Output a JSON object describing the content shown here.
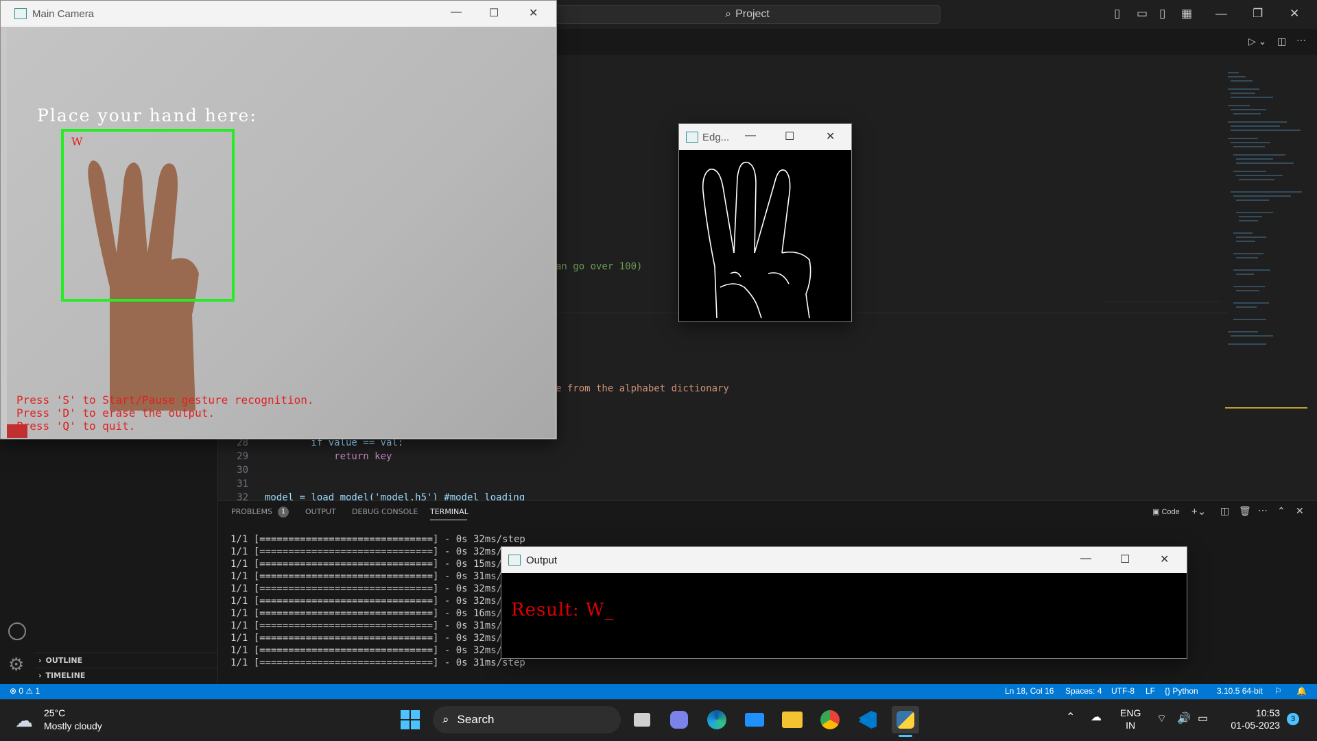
{
  "vscode": {
    "search_label": "Project",
    "code_fragments": {
      "line_a": "an go over 100)",
      "line_b": "e from the alphabet dictionary"
    },
    "code_lines": [
      {
        "num": "28",
        "text": "        if value == val:"
      },
      {
        "num": "29",
        "text": "            return key"
      },
      {
        "num": "30",
        "text": ""
      },
      {
        "num": "31",
        "text": ""
      },
      {
        "num": "32",
        "text": "model = load_model('model.h5') #model loading"
      }
    ],
    "sidebar_sections": [
      "OUTLINE",
      "TIMELINE"
    ],
    "panel_tabs": [
      "PROBLEMS",
      "OUTPUT",
      "DEBUG CONSOLE",
      "TERMINAL"
    ],
    "problems_count": "1",
    "panel_actions": {
      "code_label": "Code"
    },
    "terminal_lines": [
      "1/1 [==============================] - 0s 32ms/step",
      "1/1 [==============================] - 0s 32ms/st",
      "1/1 [==============================] - 0s 15ms/st",
      "1/1 [==============================] - 0s 31ms/st",
      "1/1 [==============================] - 0s 32ms/st",
      "1/1 [==============================] - 0s 32ms/st",
      "1/1 [==============================] - 0s 16ms/st",
      "1/1 [==============================] - 0s 31ms/st",
      "1/1 [==============================] - 0s 32ms/st",
      "1/1 [==============================] - 0s 32ms/st",
      "1/1 [==============================] - 0s 31ms/step"
    ],
    "status": {
      "errors": "0",
      "warnings": "1",
      "position": "Ln 18, Col 16",
      "spaces": "Spaces: 4",
      "encoding": "UTF-8",
      "eol": "LF",
      "language": "Python",
      "interpreter": "3.10.5 64-bit"
    }
  },
  "camera_window": {
    "title": "Main Camera",
    "prompt": "Place your hand here:",
    "detected_letter": "W",
    "instructions": [
      "Press 'S' to Start/Pause gesture recognition.",
      "Press 'D' to erase the output.",
      "Press 'Q' to quit."
    ]
  },
  "edge_window": {
    "title": "Edg..."
  },
  "output_window": {
    "title": "Output",
    "result_text": "Result: W_"
  },
  "taskbar": {
    "weather_temp": "25°C",
    "weather_desc": "Mostly cloudy",
    "search_label": "Search",
    "lang_line1": "ENG",
    "lang_line2": "IN",
    "time": "10:53",
    "date": "01-05-2023",
    "notification_count": "3"
  },
  "colors": {
    "statusbar": "#0078d4",
    "box_green": "#22ee22",
    "overlay_red": "#e02020"
  }
}
